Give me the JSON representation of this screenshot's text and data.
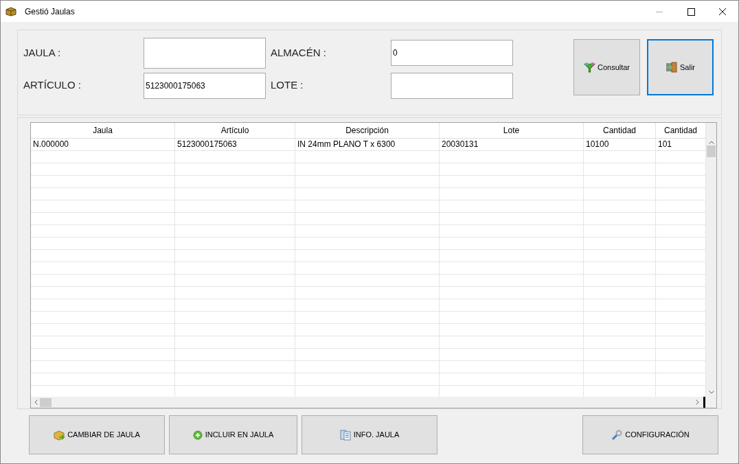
{
  "window": {
    "title": "Gestió Jaulas"
  },
  "fields": [
    {
      "label": "JAULA :"
    },
    {
      "label": "ALMACÉN :",
      "value": "0"
    },
    {
      "label": "ARTÍCULO :",
      "value": "5123000175063"
    },
    {
      "label": "LOTE :"
    }
  ],
  "actions": [
    {
      "label": "Consultar",
      "focused": false
    },
    {
      "label": "Salir",
      "focused": true
    }
  ],
  "table": {
    "columns": [
      "Jaula",
      "Artículo",
      "Descripción",
      "Lote",
      "Cantidad",
      "Cantidad"
    ],
    "rows": [
      [
        "N.000000",
        "5123000175063",
        "IN 24mm PLANO T x 6300",
        "20030131",
        "10100",
        "101"
      ]
    ]
  },
  "bottom_buttons": [
    {
      "label": "CAMBIAR DE JAULA"
    },
    {
      "label": "INCLUIR EN JAULA"
    },
    {
      "label": "INFO. JAULA"
    },
    {
      "label": "CONFIGURACIÓN"
    }
  ]
}
